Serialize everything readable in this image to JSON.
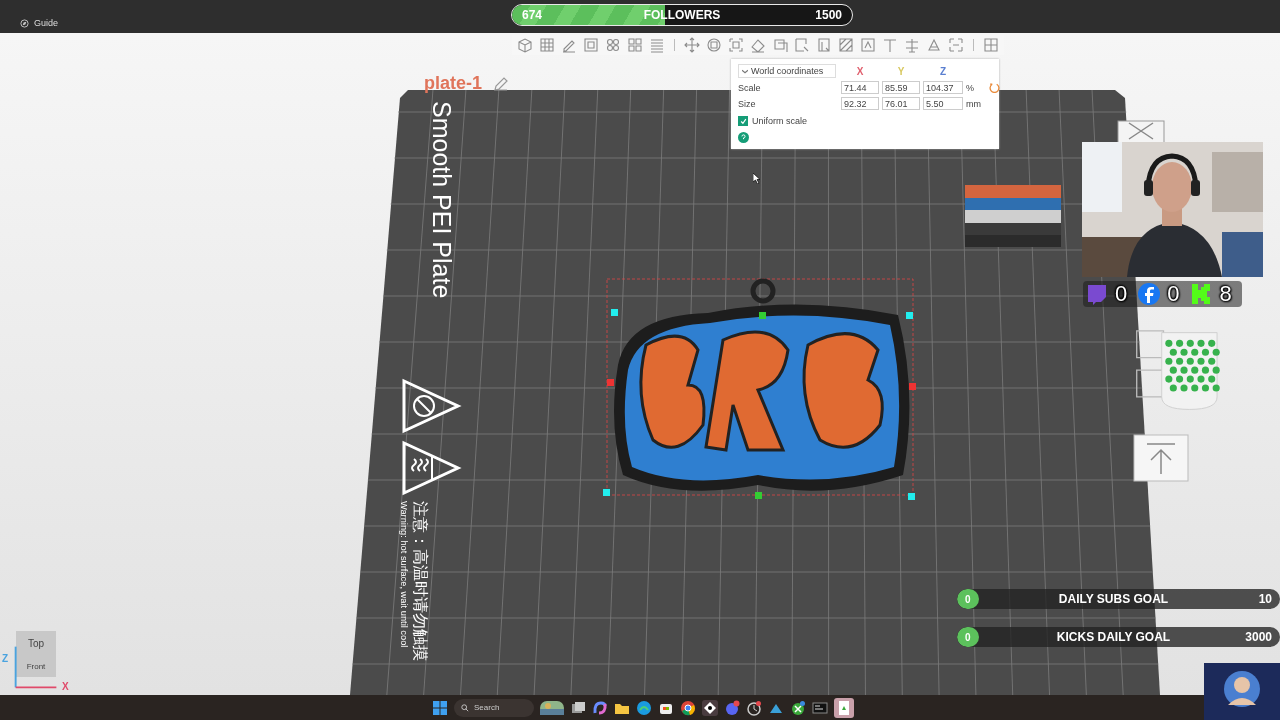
{
  "app_bar": {
    "guide_label": "Guide"
  },
  "followers_goal": {
    "current": "674",
    "label": "FOLLOWERS",
    "target": "1500",
    "level": 0.45
  },
  "plate": {
    "name": "plate-1",
    "surface": "Smooth PEI Plate",
    "warning_cn": "注意：高温时请勿触摸",
    "warning_en": "Warning: hot surface, wait until cool"
  },
  "transform_panel": {
    "mode": "World coordinates",
    "axes": [
      {
        "label": "X",
        "color": "#e0606e"
      },
      {
        "label": "Y",
        "color": "#d8c860"
      },
      {
        "label": "Z",
        "color": "#5a7fd0"
      }
    ],
    "rows": [
      {
        "label": "Scale",
        "values": [
          "71.44",
          "85.59",
          "104.37"
        ],
        "unit": "%"
      },
      {
        "label": "Size",
        "values": [
          "92.32",
          "76.01",
          "5.50"
        ],
        "unit": "mm"
      }
    ],
    "uniform_scale": {
      "label": "Uniform scale",
      "checked": true
    }
  },
  "view_cube": {
    "face": "Top",
    "side": "Front",
    "axes": [
      "Z",
      "X"
    ]
  },
  "social_counters": [
    {
      "kind": "twitch",
      "count": "0"
    },
    {
      "kind": "facebook",
      "count": "0"
    },
    {
      "kind": "kick",
      "count": "8"
    }
  ],
  "goals": [
    {
      "current": "0",
      "label": "DAILY SUBS GOAL",
      "target": "10",
      "level": 0
    },
    {
      "current": "0",
      "label": "KICKS DAILY GOAL",
      "target": "3000",
      "level": 0
    }
  ],
  "taskbar": {
    "search_placeholder": "Search"
  }
}
